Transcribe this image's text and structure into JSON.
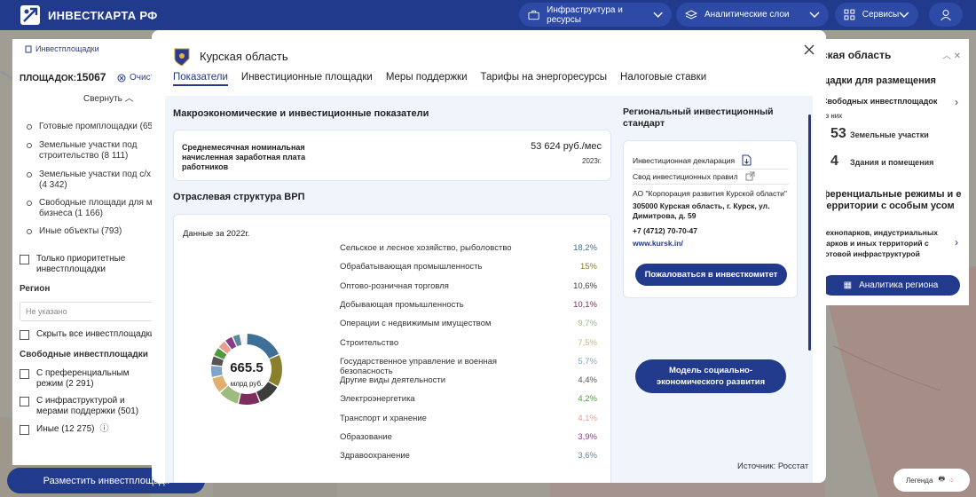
{
  "app": {
    "logo_text": "ИНВЕСТКАРТА РФ"
  },
  "nav": {
    "infrastructure": "Инфраструктура и ресурсы",
    "layers": "Аналитические слои",
    "services": "Сервисы"
  },
  "left_panel": {
    "tab_label": "Инвестплощадки",
    "count_label": "ПЛОЩАДОК:",
    "count_value": "15067",
    "clear_label": "Очист",
    "collapse_label": "Свернуть",
    "categories": [
      "Готовые промплощадки (65",
      "Земельные участки под строительство (8 111)",
      "Земельные участки под с/х (4 342)",
      "Свободные площади для ме бизнеса (1 166)",
      "Иные объекты (793)"
    ],
    "priority_label": "Только приоритетные инвестплощадки",
    "region_title": "Регион",
    "region_placeholder": "Не указано",
    "hide_all_label": "Скрыть все инвестплощадки",
    "free_title": "Свободные инвестплощадки",
    "free_options": [
      "С преференциальным режим (2 291)",
      "С инфраструктурой и мерами поддержки (501)",
      "Иные (12 275)"
    ],
    "place_button": "Разместить инвестплощадк"
  },
  "right_panel": {
    "title": "ская область",
    "subtitle": "щадки для размещения",
    "free_label": "Свободных инвестплощадок",
    "of_label": "из них",
    "land_count": "53",
    "land_label": "Земельные участки",
    "buildings_count": "4",
    "buildings_label": "Здания и помещения",
    "pref_title": "ференциальные режимы и е территории с особым усом",
    "parks_label": "Технопарков, индустриальных парков и иных территорий с готовой инфраструктурой",
    "analytics_button": "Аналитика региона",
    "legend_label": "Легенда"
  },
  "modal": {
    "title": "Курская область",
    "tabs": [
      "Показатели",
      "Инвестиционные площадки",
      "Меры поддержки",
      "Тарифы на энергоресурсы",
      "Налоговые ставки"
    ],
    "macro_title": "Макроэкономические и инвестиционные показатели",
    "salary_label": "Среднемесячная номинальная начисленная заработная плата работников",
    "salary_value": "53 624 руб./мес",
    "salary_year": "2023г.",
    "vrp_title": "Отраслевая структура ВРП",
    "vrp_year_label": "Данные за 2022г.",
    "donut_value": "665.5",
    "donut_unit": "млрд руб.",
    "standard_title": "Региональный инвестиционный стандарт",
    "std_declaration": "Инвестиционная декларация",
    "std_rules": "Свод инвестиционных правил",
    "std_org": "АО \"Корпорация развития Курской области\"",
    "std_address": "305000 Курская область, г. Курск, ул. Димитрова, д. 59",
    "std_phone": "+7 (4712) 70-70-47",
    "std_url": "www.kursk.in/",
    "complain_button": "Пожаловаться в инвесткомитет",
    "model_button": "Модель социально-экономического развития",
    "source": "Источник: Росстат"
  },
  "chart_data": {
    "type": "pie",
    "title": "Отраслевая структура ВРП",
    "total": "665.5",
    "unit": "млрд руб.",
    "categories": [
      "Сельское и лесное хозяйство, рыболовство",
      "Обрабатывающая промышленность",
      "Оптово-розничная торговля",
      "Добывающая промышленность",
      "Операции с недвижимым имуществом",
      "Строительство",
      "Государственное управление и военная безопасность",
      "Другие виды деятельности",
      "Электроэнергетика",
      "Транспорт и хранение",
      "Образование",
      "Здравоохранение"
    ],
    "labels": [
      "18,2%",
      "15%",
      "10,6%",
      "10,1%",
      "9,7%",
      "7,5%",
      "5,7%",
      "4,4%",
      "4,2%",
      "4,1%",
      "3,9%",
      "3,6%"
    ],
    "values": [
      18.2,
      15,
      10.6,
      10.1,
      9.7,
      7.5,
      5.7,
      4.4,
      4.2,
      4.1,
      3.9,
      3.6
    ],
    "colors": [
      "#3e6f96",
      "#8a7f2d",
      "#3d3d3d",
      "#7c2e5e",
      "#9dbb7f",
      "#e0b070",
      "#7fa4c8",
      "#555555",
      "#4e9a3e",
      "#e7a08f",
      "#8c3a8a",
      "#5a8a9a"
    ],
    "extra_colors": [
      "#6a6a6a",
      "#5d8e4a",
      "#b44f7f",
      "#4c7e8f",
      "#a8c4d4"
    ]
  }
}
